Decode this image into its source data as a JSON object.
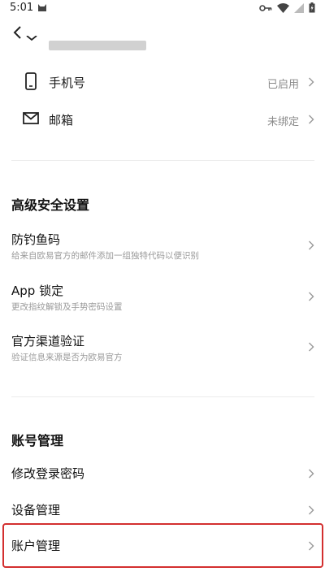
{
  "status_bar": {
    "time": "5:01"
  },
  "partial_item": {
    "label": "…"
  },
  "contact": [
    {
      "label": "手机号",
      "status": "已启用"
    },
    {
      "label": "邮箱",
      "status": "未绑定"
    }
  ],
  "advanced": {
    "title": "高级安全设置",
    "items": [
      {
        "title": "防钓鱼码",
        "subtitle": "给来自欧易官方的邮件添加一组独特代码以便识别"
      },
      {
        "title": "App 锁定",
        "subtitle": "更改指纹解锁及手势密码设置"
      },
      {
        "title": "官方渠道验证",
        "subtitle": "验证信息来源是否为欧易官方"
      }
    ]
  },
  "account": {
    "title": "账号管理",
    "items": [
      {
        "title": "修改登录密码"
      },
      {
        "title": "设备管理"
      },
      {
        "title": "账户管理"
      }
    ]
  },
  "colors": {
    "highlight": "#d32f2f",
    "muted": "#8a8a8a"
  }
}
